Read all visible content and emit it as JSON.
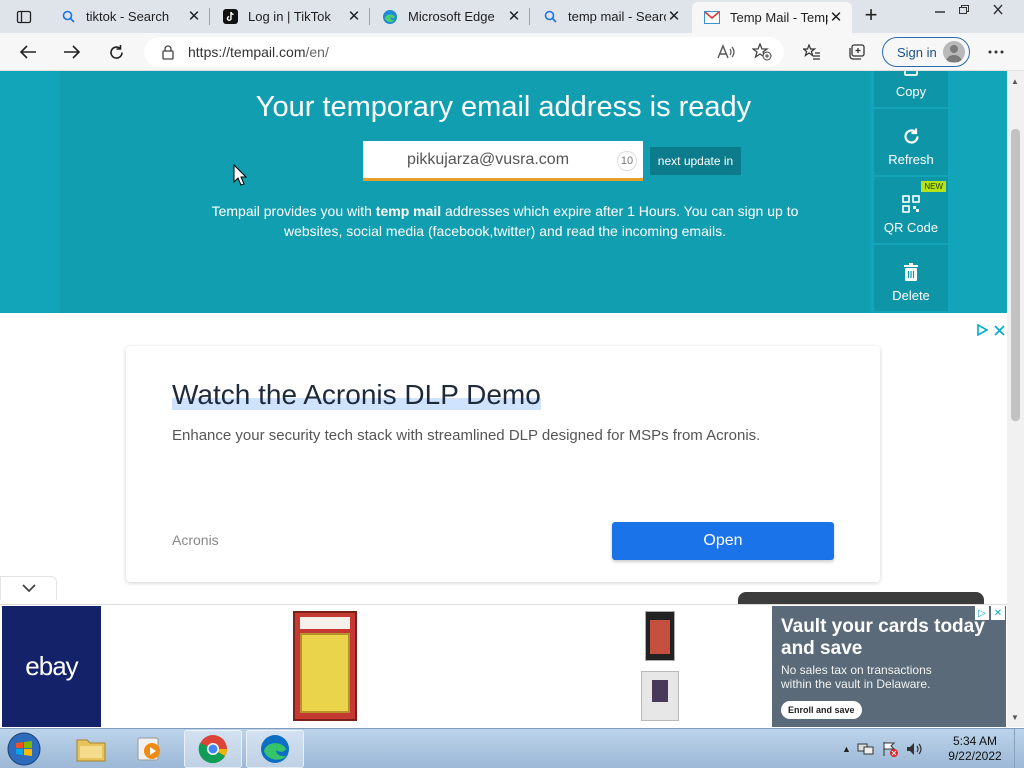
{
  "browser": {
    "tabs": [
      {
        "label": "tiktok - Search",
        "icon": "search-icon"
      },
      {
        "label": "Log in | TikTok",
        "icon": "tiktok-icon"
      },
      {
        "label": "Microsoft Edge",
        "icon": "edge-icon"
      },
      {
        "label": "temp mail - Search",
        "icon": "search-icon"
      },
      {
        "label": "Temp Mail - Temporary",
        "icon": "mail-icon"
      }
    ],
    "url_main": "https://tempail.com",
    "url_path": "/en/",
    "signin_label": "Sign in"
  },
  "hero": {
    "title": "Your temporary email address is ready",
    "email": "pikkujarza@vusra.com",
    "countdown": "10",
    "next_update_label": "next update in",
    "desc_prefix": "Tempail provides you with ",
    "desc_bold": "temp mail",
    "desc_suffix": " addresses which expire after 1 Hours. You can sign up to websites, social media (facebook,twitter) and read the incoming emails."
  },
  "side_actions": {
    "copy": "Copy",
    "refresh": "Refresh",
    "qr": "QR Code",
    "qr_badge": "NEW",
    "delete": "Delete"
  },
  "ad": {
    "title": "Watch the Acronis DLP Demo",
    "body": "Enhance your security tech stack with streamlined DLP designed for MSPs from Acronis.",
    "brand": "Acronis",
    "cta": "Open"
  },
  "ebay_ad": {
    "logo": "ebay",
    "headline": "Vault your cards today and save",
    "sub": "No sales tax on transactions within the vault in Delaware.",
    "button": "Enroll and save"
  },
  "taskbar": {
    "time": "5:34 AM",
    "date": "9/22/2022"
  }
}
